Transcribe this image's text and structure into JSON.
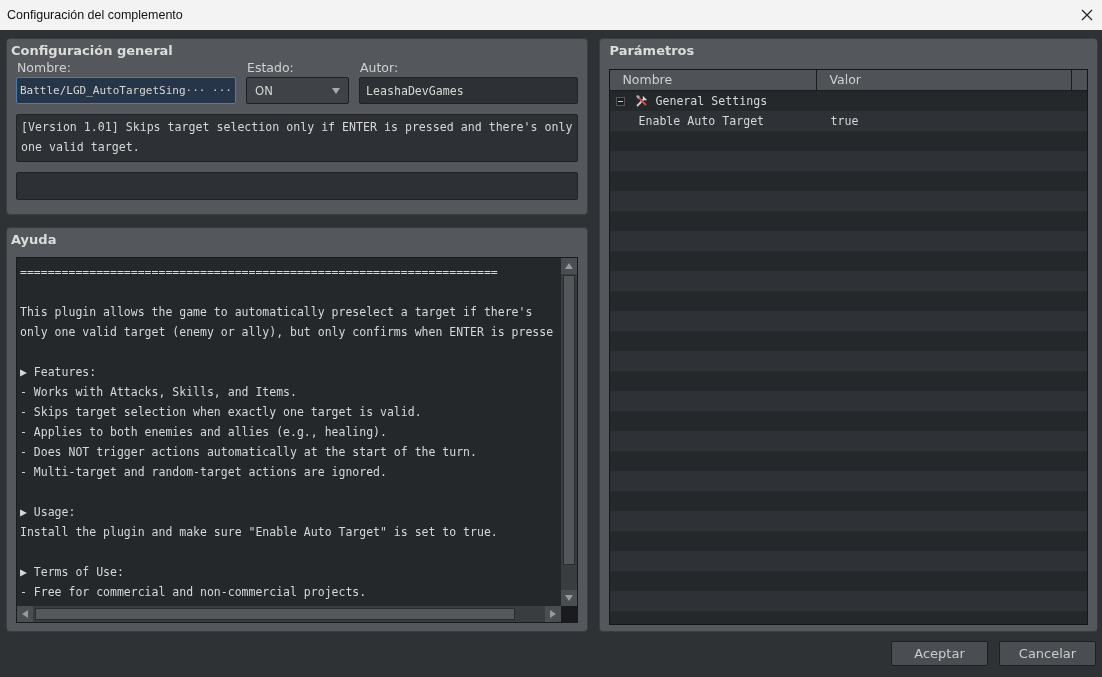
{
  "window": {
    "title": "Configuración del complemento"
  },
  "general": {
    "title": "Configuración general",
    "name_label": "Nombre:",
    "name_value": "Battle/LGD_AutoTargetSing··· ···",
    "name_focused": true,
    "state_label": "Estado:",
    "state_value": "ON",
    "author_label": "Autor:",
    "author_value": "LeashaDevGames",
    "description": "[Version 1.01] Skips target selection only if ENTER is pressed and there's only one valid target."
  },
  "help": {
    "title": "Ayuda",
    "lines": [
      {
        "kind": "text",
        "text": "====================================================================="
      },
      {
        "kind": "blank"
      },
      {
        "kind": "text",
        "text": "This plugin allows the game to automatically preselect a target if there's"
      },
      {
        "kind": "text",
        "text": "only one valid target (enemy or ally), but only confirms when ENTER is presse"
      },
      {
        "kind": "blank"
      },
      {
        "kind": "text",
        "text": "▶ Features:"
      },
      {
        "kind": "text",
        "text": "- Works with Attacks, Skills, and Items."
      },
      {
        "kind": "text",
        "text": "- Skips target selection when exactly one target is valid."
      },
      {
        "kind": "text",
        "text": "- Applies to both enemies and allies (e.g., healing)."
      },
      {
        "kind": "text",
        "text": "- Does NOT trigger actions automatically at the start of the turn."
      },
      {
        "kind": "text",
        "text": "- Multi-target and random-target actions are ignored."
      },
      {
        "kind": "blank"
      },
      {
        "kind": "text",
        "text": "▶ Usage:"
      },
      {
        "kind": "text",
        "text": "Install the plugin and make sure \"Enable Auto Target\" is set to true."
      },
      {
        "kind": "blank"
      },
      {
        "kind": "text",
        "text": "▶ Terms of Use:"
      },
      {
        "kind": "text",
        "text": "- Free for commercial and non-commercial projects."
      }
    ]
  },
  "parameters": {
    "title": "Parámetros",
    "columns": [
      "Nombre",
      "Valor"
    ],
    "rows": [
      {
        "name": "General Settings",
        "expanded": true,
        "children": [
          {
            "name": "Enable Auto Target",
            "value": "true"
          }
        ]
      }
    ]
  },
  "buttons": [
    "Aceptar",
    "Cancelar"
  ]
}
